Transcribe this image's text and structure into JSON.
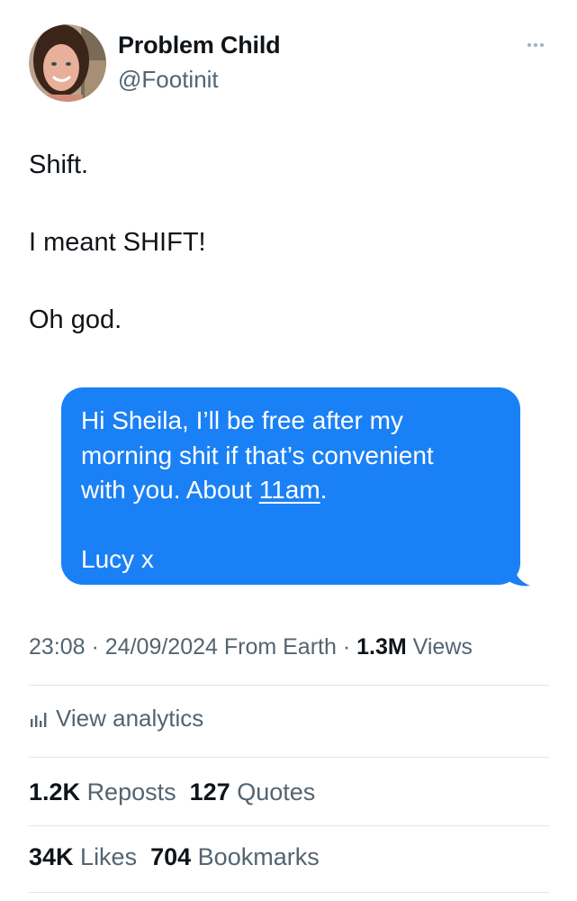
{
  "author": {
    "display_name": "Problem Child",
    "handle": "@Footinit"
  },
  "tweet": {
    "lines": [
      "Shift.",
      "I meant SHIFT!",
      "Oh god."
    ]
  },
  "message": {
    "line1": "Hi Sheila, I’ll be free after my",
    "line2": "morning shit if that’s convenient",
    "line3_before": "with you. About ",
    "line3_link": "11am",
    "line3_after": ".",
    "signoff": "Lucy x",
    "bubble_color": "#1a80f6"
  },
  "meta": {
    "time": "23:08",
    "separator": " · ",
    "date": "24/09/2024",
    "source": "From Earth",
    "views_count": "1.3M",
    "views_label": "Views"
  },
  "analytics": {
    "label": "View analytics",
    "icon": "bar-chart-icon"
  },
  "stats": {
    "reposts_count": "1.2K",
    "reposts_label": "Reposts",
    "quotes_count": "127",
    "quotes_label": "Quotes",
    "likes_count": "34K",
    "likes_label": "Likes",
    "bookmarks_count": "704",
    "bookmarks_label": "Bookmarks"
  },
  "colors": {
    "text": "#0f1419",
    "muted": "#536471",
    "divider": "#e2e6e9"
  }
}
